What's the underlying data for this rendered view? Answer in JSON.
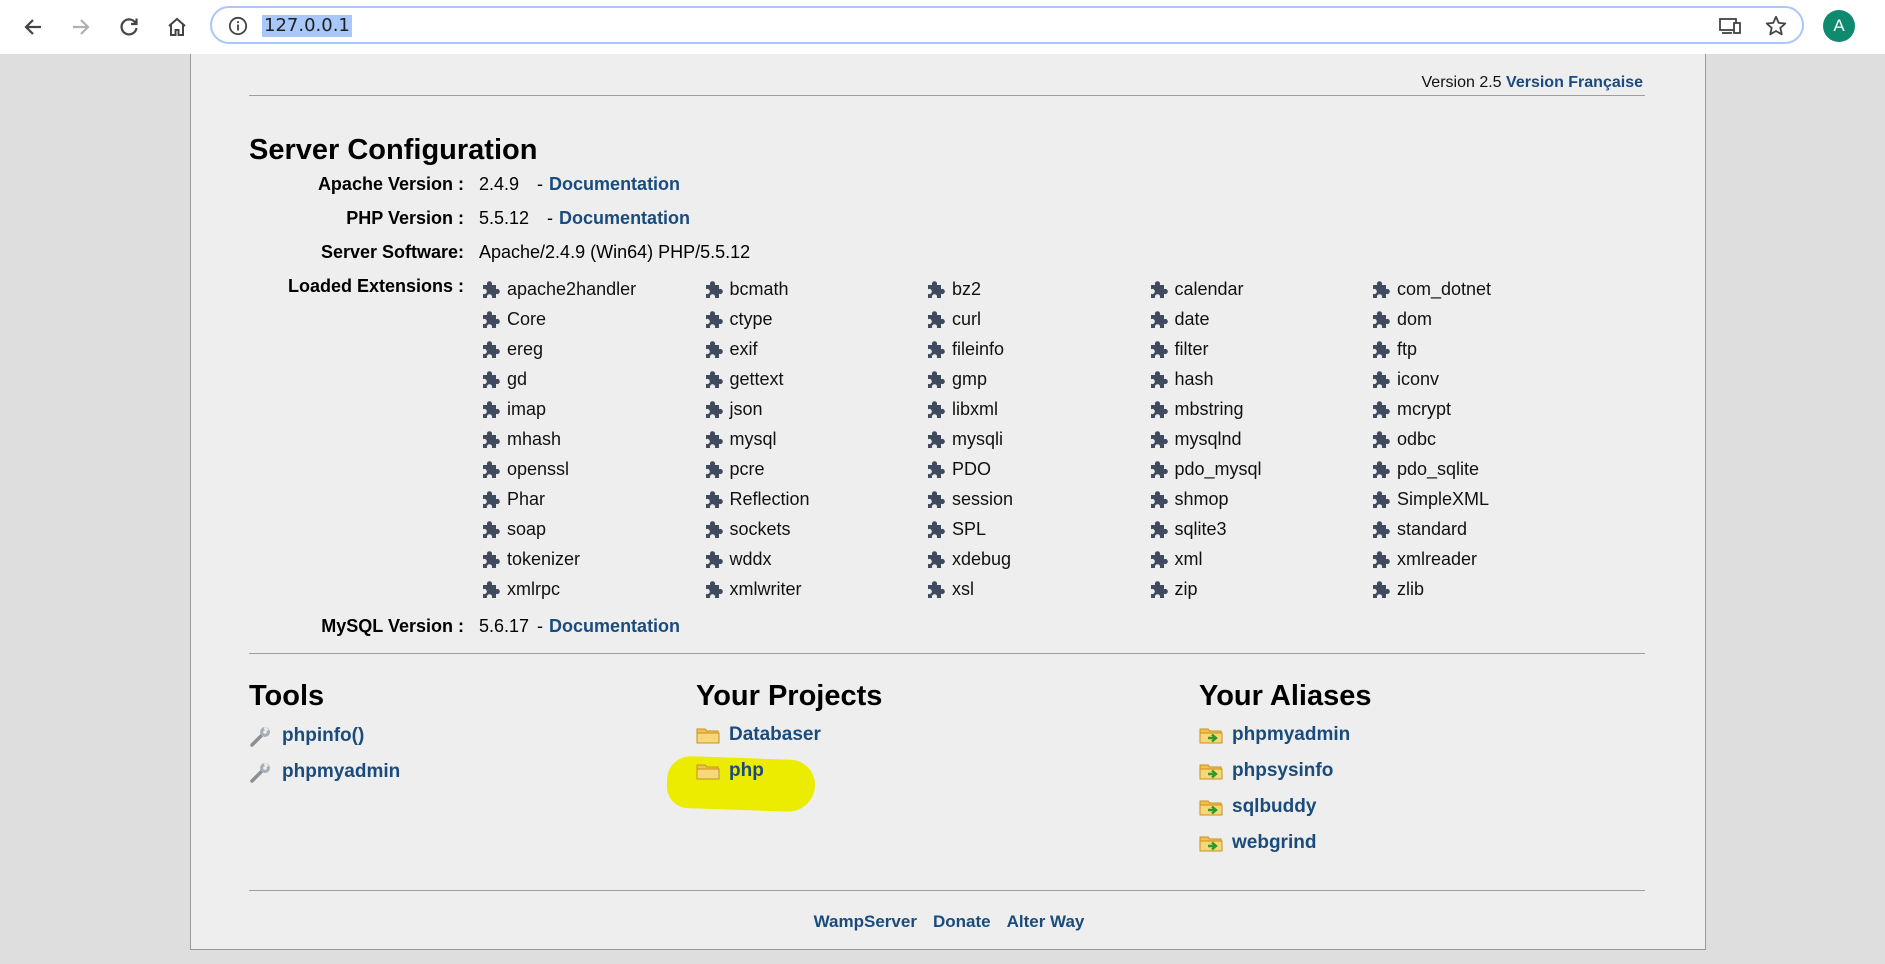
{
  "browser": {
    "url": "127.0.0.1",
    "avatar_letter": "A",
    "icons": [
      "back-arrow-icon",
      "forward-arrow-icon",
      "reload-icon",
      "home-icon",
      "info-icon",
      "cast-icon",
      "star-icon"
    ]
  },
  "header": {
    "version_text": "Version 2.5",
    "version_link": "Version Française"
  },
  "server_config": {
    "title": "Server Configuration",
    "apache": {
      "label": "Apache Version :",
      "value": "2.4.9",
      "sep": "-",
      "link": "Documentation"
    },
    "php": {
      "label": "PHP Version :",
      "value": "5.5.12",
      "sep": "-",
      "link": "Documentation"
    },
    "software": {
      "label": "Server Software:",
      "value": "Apache/2.4.9 (Win64) PHP/5.5.12"
    },
    "extensions_label": "Loaded Extensions :",
    "extensions": [
      "apache2handler",
      "bcmath",
      "bz2",
      "calendar",
      "com_dotnet",
      "Core",
      "ctype",
      "curl",
      "date",
      "dom",
      "ereg",
      "exif",
      "fileinfo",
      "filter",
      "ftp",
      "gd",
      "gettext",
      "gmp",
      "hash",
      "iconv",
      "imap",
      "json",
      "libxml",
      "mbstring",
      "mcrypt",
      "mhash",
      "mysql",
      "mysqli",
      "mysqlnd",
      "odbc",
      "openssl",
      "pcre",
      "PDO",
      "pdo_mysql",
      "pdo_sqlite",
      "Phar",
      "Reflection",
      "session",
      "shmop",
      "SimpleXML",
      "soap",
      "sockets",
      "SPL",
      "sqlite3",
      "standard",
      "tokenizer",
      "wddx",
      "xdebug",
      "xml",
      "xmlreader",
      "xmlrpc",
      "xmlwriter",
      "xsl",
      "zip",
      "zlib"
    ],
    "mysql": {
      "label": "MySQL Version :",
      "value": "5.6.17",
      "sep": "-",
      "link": "Documentation"
    }
  },
  "tools": {
    "title": "Tools",
    "items": [
      "phpinfo()",
      "phpmyadmin"
    ]
  },
  "projects": {
    "title": "Your Projects",
    "items": [
      "Databaser",
      "php"
    ],
    "highlight_color": "#ecec00"
  },
  "aliases": {
    "title": "Your Aliases",
    "items": [
      "phpmyadmin",
      "phpsysinfo",
      "sqlbuddy",
      "webgrind"
    ]
  },
  "footer": {
    "links": [
      "WampServer",
      "Donate",
      "Alter Way"
    ]
  },
  "colors": {
    "link": "#1a4b7d",
    "page_bg": "#eeeeee",
    "outer_bg": "#dedede"
  }
}
